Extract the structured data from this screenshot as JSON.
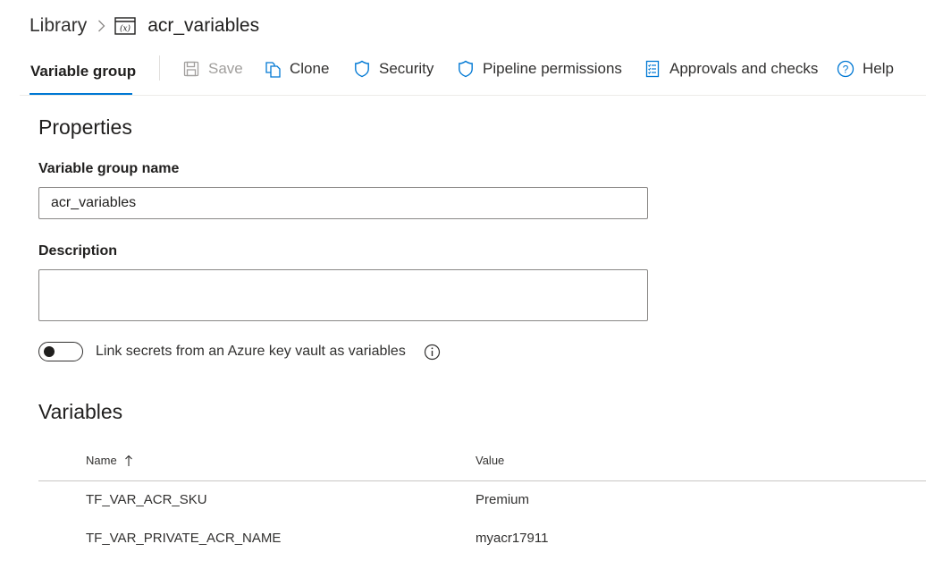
{
  "breadcrumb": {
    "root": "Library",
    "current": "acr_variables",
    "current_icon": "variable-group-icon",
    "separator_icon": "chevron-right-icon"
  },
  "toolbar": {
    "active_tab": "Variable group",
    "accent_color": "#0078d4",
    "buttons": [
      {
        "label": "Save",
        "icon": "save-icon",
        "disabled": true
      },
      {
        "label": "Clone",
        "icon": "clone-icon",
        "disabled": false
      },
      {
        "label": "Security",
        "icon": "shield-icon",
        "disabled": false
      },
      {
        "label": "Pipeline permissions",
        "icon": "shield-icon",
        "disabled": false
      },
      {
        "label": "Approvals and checks",
        "icon": "checklist-icon",
        "disabled": false
      },
      {
        "label": "Help",
        "icon": "help-icon",
        "disabled": false
      }
    ]
  },
  "properties": {
    "title": "Properties",
    "name_label": "Variable group name",
    "name_value": "acr_variables",
    "description_label": "Description",
    "description_value": "",
    "keyvault_toggle_label": "Link secrets from an Azure key vault as variables",
    "keyvault_toggle_on": false
  },
  "variables": {
    "title": "Variables",
    "columns": {
      "name": "Name",
      "value": "Value"
    },
    "sort_icon": "arrow-up-icon",
    "rows": [
      {
        "name": "TF_VAR_ACR_SKU",
        "value": "Premium"
      },
      {
        "name": "TF_VAR_PRIVATE_ACR_NAME",
        "value": "myacr17911"
      }
    ]
  }
}
